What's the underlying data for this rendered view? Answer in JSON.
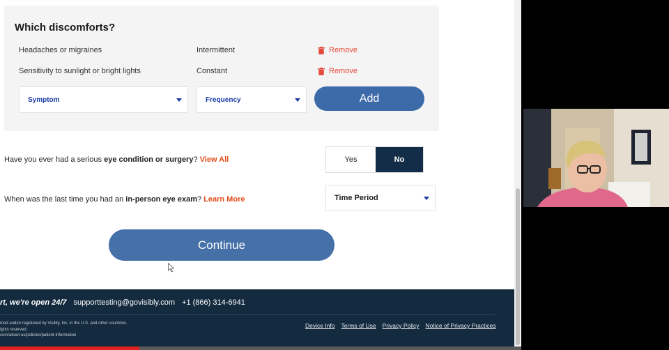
{
  "discomforts": {
    "heading": "Which discomforts?",
    "rows": [
      {
        "symptom": "Headaches or migraines",
        "frequency": "Intermittent",
        "remove": "Remove"
      },
      {
        "symptom": "Sensitivity to sunlight or bright lights",
        "frequency": "Constant",
        "remove": "Remove"
      }
    ],
    "symptom_select": "Symptom",
    "frequency_select": "Frequency",
    "add_label": "Add"
  },
  "q_condition": {
    "prefix": "Have you ever had a serious ",
    "bold": "eye condition or surgery",
    "suffix": "? ",
    "link": "View All",
    "yes": "Yes",
    "no": "No",
    "selected": "No"
  },
  "q_exam": {
    "prefix": "When was the last time you had an ",
    "bold": "in-person eye exam",
    "suffix": "? ",
    "link": "Learn More",
    "select": "Time Period"
  },
  "continue_label": "Continue",
  "footer": {
    "support": "rt, we're open 24/7",
    "email": "supporttesting@govisibly.com",
    "phone": "+1 (866) 314-6941",
    "legal_1": "med and/or registered by Visibly, Inc. in the U.S. and other countries.",
    "legal_2": "ights reserved.",
    "legal_3": "com/about-us/policies/patient-information",
    "links": [
      "Device Info",
      "Terms of Use",
      "Privacy Policy",
      "Notice of Privacy Practices"
    ]
  },
  "colors": {
    "accent_blue": "#3d6aa8",
    "dark_navy": "#142a3e",
    "link_orange": "#e24b1a",
    "remove_red": "#e5493a"
  }
}
